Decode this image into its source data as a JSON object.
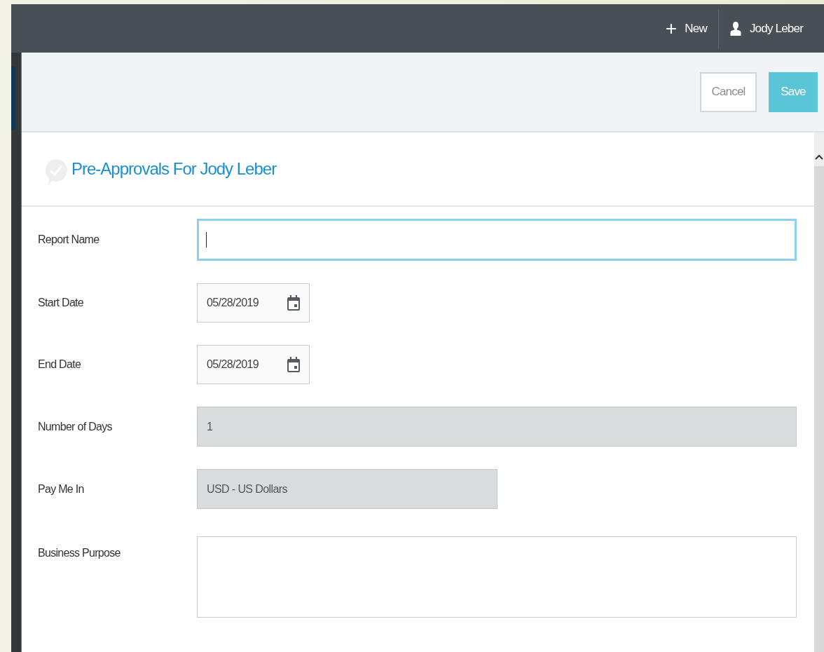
{
  "header": {
    "new_button": {
      "icon": "+",
      "label": "New"
    },
    "user": {
      "name": "Jody Leber"
    }
  },
  "toolbar": {
    "buttons": [
      {
        "label": "Cancel",
        "kind": "secondary"
      },
      {
        "label": "Save",
        "kind": "primary"
      }
    ]
  },
  "page_title": "Pre-Approvals For Jody Leber",
  "fields": [
    {
      "label": "Report Name",
      "kind": "text",
      "focused": true
    },
    {
      "label": "Start Date",
      "kind": "date",
      "value": "05/28/2019"
    },
    {
      "label": "End Date",
      "kind": "date",
      "value": "05/28/2019"
    },
    {
      "label": "Number of Days",
      "kind": "readonly",
      "value": "1"
    },
    {
      "label": "Pay Me In",
      "kind": "readonly_short",
      "value": "USD - US Dollars"
    },
    {
      "label": "Business Purpose",
      "kind": "textarea"
    }
  ]
}
